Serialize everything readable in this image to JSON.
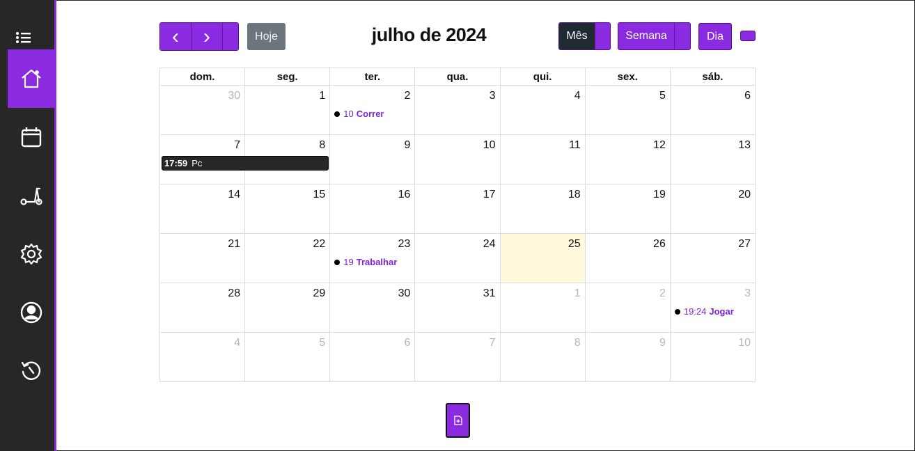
{
  "sidebar": {
    "items": [
      {
        "name": "home-icon",
        "active": true
      },
      {
        "name": "calendar-icon",
        "active": false
      },
      {
        "name": "scooter-icon",
        "active": false
      },
      {
        "name": "settings-icon",
        "active": false
      },
      {
        "name": "user-icon",
        "active": false
      },
      {
        "name": "history-icon",
        "active": false
      }
    ]
  },
  "toolbar": {
    "prev_icon": "‹",
    "next_icon": "›",
    "today_label": "Hoje",
    "title": "julho de 2024",
    "view_month": "Mês",
    "view_week": "Semana",
    "view_day": "Dia"
  },
  "calendar": {
    "weekdays": [
      "dom.",
      "seg.",
      "ter.",
      "qua.",
      "qui.",
      "sex.",
      "sáb."
    ],
    "weeks": [
      [
        {
          "d": "30",
          "o": true
        },
        {
          "d": "1"
        },
        {
          "d": "2"
        },
        {
          "d": "3"
        },
        {
          "d": "4"
        },
        {
          "d": "5"
        },
        {
          "d": "6"
        }
      ],
      [
        {
          "d": "7"
        },
        {
          "d": "8"
        },
        {
          "d": "9"
        },
        {
          "d": "10"
        },
        {
          "d": "11"
        },
        {
          "d": "12"
        },
        {
          "d": "13"
        }
      ],
      [
        {
          "d": "14"
        },
        {
          "d": "15"
        },
        {
          "d": "16"
        },
        {
          "d": "17"
        },
        {
          "d": "18"
        },
        {
          "d": "19"
        },
        {
          "d": "20"
        }
      ],
      [
        {
          "d": "21"
        },
        {
          "d": "22"
        },
        {
          "d": "23"
        },
        {
          "d": "24"
        },
        {
          "d": "25",
          "today": true
        },
        {
          "d": "26"
        },
        {
          "d": "27"
        }
      ],
      [
        {
          "d": "28"
        },
        {
          "d": "29"
        },
        {
          "d": "30"
        },
        {
          "d": "31"
        },
        {
          "d": "1",
          "o": true
        },
        {
          "d": "2",
          "o": true
        },
        {
          "d": "3",
          "o": true
        }
      ],
      [
        {
          "d": "4",
          "o": true
        },
        {
          "d": "5",
          "o": true
        },
        {
          "d": "6",
          "o": true
        },
        {
          "d": "7",
          "o": true
        },
        {
          "d": "8",
          "o": true
        },
        {
          "d": "9",
          "o": true
        },
        {
          "d": "10",
          "o": true
        }
      ]
    ],
    "events": [
      {
        "week": 0,
        "day": 2,
        "time": "10",
        "name": "Correr"
      },
      {
        "week": 3,
        "day": 2,
        "time": "19",
        "name": "Trabalhar"
      },
      {
        "week": 4,
        "day": 6,
        "time": "19:24",
        "name": "Jogar"
      }
    ],
    "block_event": {
      "time": "17:59",
      "name": "Pc"
    }
  },
  "colors": {
    "accent": "#8a2be2",
    "sidebar": "#272727",
    "today": "#fff8dc",
    "dark_button": "#1f2a33"
  }
}
